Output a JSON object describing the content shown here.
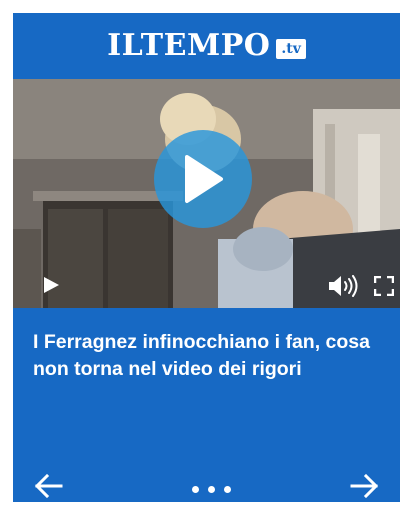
{
  "brand": {
    "logo_text": "ILTEMPO",
    "logo_suffix": ".tv"
  },
  "video": {
    "headline": "I Ferragnez infinocchiano i fan, cosa non torna nel video dei rigori",
    "icons": {
      "big_play": "play-icon",
      "small_play": "play-icon",
      "volume": "volume-icon",
      "fullscreen": "fullscreen-icon"
    }
  },
  "navigation": {
    "prev_icon": "arrow-left-icon",
    "next_icon": "arrow-right-icon",
    "dots_icon": "pagination-dots"
  },
  "colors": {
    "brand_blue": "#1769c4",
    "play_button": "#2896dc",
    "text": "#ffffff"
  }
}
